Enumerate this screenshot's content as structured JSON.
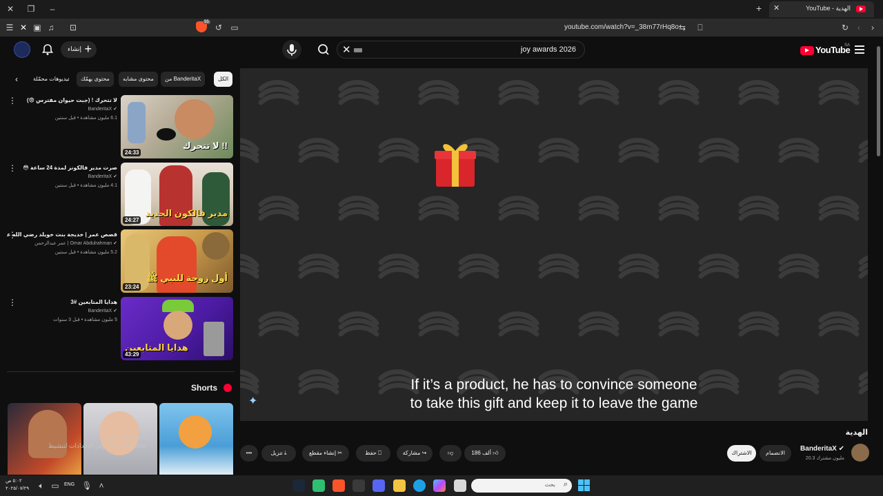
{
  "browser": {
    "tab_title": "YouTube - الهدية",
    "url": "youtube.com/watch?v=_38m77rHq8o",
    "shields_count": "55"
  },
  "header": {
    "logo_text": "YouTube",
    "region": "SA",
    "search_query": "joy awards 2026",
    "create_label": "إنشاء"
  },
  "player": {
    "subtitle_line1": "If it’s a product, he has to convince someone",
    "subtitle_line2": "to take this gift and keep it to leave the game"
  },
  "video": {
    "title": "الهدية",
    "channel_name": "BanderitaX",
    "subscribers": "20.3 مليون مشترك",
    "join_label": "الانضمام",
    "subscribe_label": "الاشتراك",
    "likes": "186 ألف",
    "share_label": "مشاركة",
    "save_label": "حفظ",
    "clip_label": "إنشاء مقطع",
    "download_label": "تنزيل"
  },
  "chips": [
    {
      "label": "الكل",
      "active": true
    },
    {
      "label": "من BanderitaX"
    },
    {
      "label": "محتوى مشابه"
    },
    {
      "label": "محتوى يهمّك"
    },
    {
      "label": "فيديوهات محمّلة"
    }
  ],
  "recommendations": [
    {
      "title": "لا تتحرك ! (جبت حيوان مفترس 😨)",
      "channel": "BanderitaX",
      "meta": "6.1 مليون مشاهدة • قبل سنتين",
      "duration": "24:33",
      "overlay": "لا تتحرك !!"
    },
    {
      "title": "صرت مدير فالكونز لمدة 24 ساعة 😳",
      "channel": "BanderitaX",
      "meta": "4.1 مليون مشاهدة • قبل سنتين",
      "duration": "24:27",
      "overlay": "مدير فالكون الجديد"
    },
    {
      "title": "قصص عمر | خديجة بنت خويلد رضي الله عنها",
      "channel": "Omar Abdulrahman | عمر عبدالرحمن",
      "meta": "5.2 مليون مشاهدة • قبل سنتين",
      "duration": "23:24",
      "overlay": "أول زوجة للنبي ﷺ"
    },
    {
      "title": "هدايا المتابعين #3",
      "channel": "BanderitaX",
      "meta": "5 مليون مشاهدة • قبل 3 سنوات",
      "duration": "43:29",
      "overlay": "هدايا المتابعين"
    }
  ],
  "shorts": {
    "title": "Shorts",
    "activate_line1": "تنشيط Windows",
    "activate_line2": "انتقل إلى الإعدادات لتنشيط Windows."
  },
  "taskbar": {
    "search_placeholder": "بحث",
    "language": "ENG",
    "time": "٥:٠٢ ص",
    "date": "٢٠٢٥/٠٧/٢٩"
  }
}
